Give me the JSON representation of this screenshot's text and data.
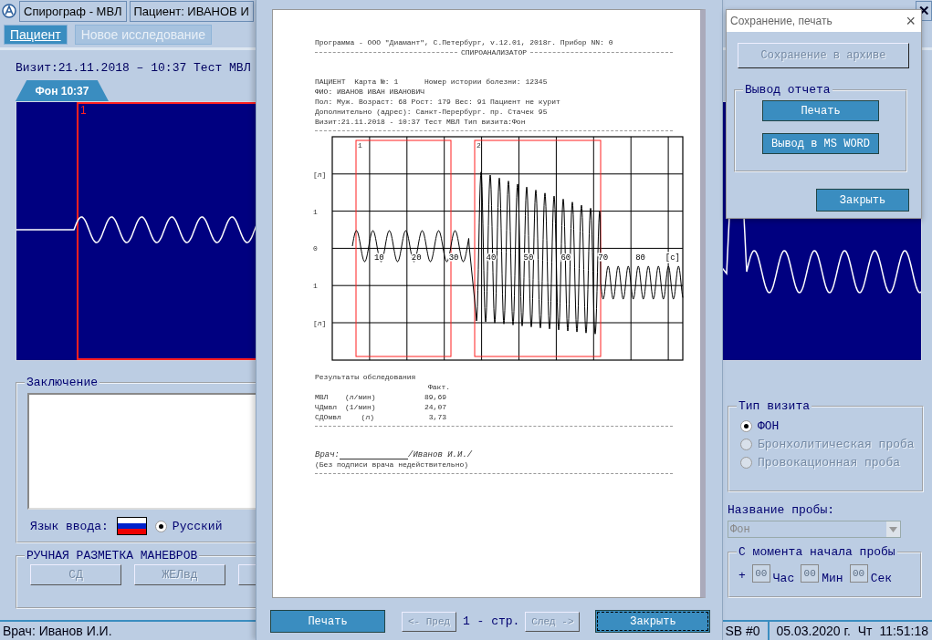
{
  "app": {
    "title": "Спирограф - МВЛ",
    "patient": "Пациент: ИВАНОВ И",
    "close_button": "✕"
  },
  "menu": [
    {
      "label": "Пациент",
      "disabled": false
    },
    {
      "label": "Новое исследование",
      "disabled": true
    }
  ],
  "visit_line": "Визит:21.11.2018 – 10:37 Тест МВЛ",
  "tabs": [
    {
      "label": "Фон 10:37",
      "selected": true
    }
  ],
  "trace": {
    "segment_label": "1"
  },
  "conclusion": {
    "legend": "Заключение",
    "language_label": "Язык ввода:",
    "language": {
      "label": "Русский",
      "selected": true
    }
  },
  "maneuvers": {
    "legend": "РУЧНАЯ РАЗМЕТКА МАНЕВРОВ",
    "buttons": [
      {
        "label": "СД",
        "disabled": true
      },
      {
        "label": "ЖЕЛвд",
        "disabled": true
      },
      {
        "disabled": true
      }
    ]
  },
  "visit_type": {
    "legend": "Тип визита",
    "options": [
      {
        "label": "ФОН",
        "selected": true,
        "disabled": false
      },
      {
        "label": "Бронхолитическая проба",
        "selected": false,
        "disabled": true
      },
      {
        "label": "Провокационная проба",
        "selected": false,
        "disabled": true
      }
    ]
  },
  "test_name": {
    "label": "Название пробы:",
    "value": "Фон",
    "disabled": true
  },
  "elapsed": {
    "legend": "С момента начала пробы",
    "prefix": "+",
    "fields": [
      {
        "placeholder": "00",
        "unit": "Час"
      },
      {
        "placeholder": "00",
        "unit": "Мин"
      },
      {
        "placeholder": "00",
        "unit": "Сек"
      }
    ]
  },
  "status_bar": {
    "doctor": "Врач: Иванов И.И.",
    "sb": "SB #0",
    "date": "05.03.2020 г.",
    "weekday": "Чт",
    "time": "11:51:18"
  },
  "preview": {
    "report": {
      "header": "Программа - ООО \"Диамант\", С.Петербург, v.12.01, 2018г. Прибор NN: 0",
      "section": "СПИРОАНАЛИЗАТОР",
      "patient_lines": [
        "ПАЦИЕНТ  Карта №: 1      Номер истории болезни: 12345",
        "ФИО: ИВАНОВ ИВАН ИВАНОВИЧ",
        "Пол: Муж. Возраст: 68 Рост: 179 Вес: 91 Пациент не курит",
        "Дополнительно (адрес): Санкт-Перербург. пр. Стачек 95",
        "Визит:21.11.2018 - 10:37 Тест МВЛ Тип визита:Фон"
      ],
      "chart": {
        "y_labels": [
          "[л]",
          "1",
          "0",
          "1",
          "[л]"
        ],
        "x_labels": [
          "10",
          "20",
          "30",
          "40",
          "50",
          "60",
          "70",
          "80",
          "[с]"
        ],
        "segments": [
          {
            "label": "1"
          },
          {
            "label": "2"
          }
        ]
      },
      "results_title": "Результаты обследования",
      "results_header": "Факт.",
      "results": [
        {
          "name": "МВЛ",
          "unit": "(л/мин)",
          "value": "89,69"
        },
        {
          "name": "ЧДмвл",
          "unit": "(1/мин)",
          "value": "24,07"
        },
        {
          "name": "СДОмвл",
          "unit": "(л)",
          "value": "3,73"
        }
      ],
      "doctor_label": "Врач:",
      "doctor_name": "/Иванов И.И./",
      "signature_note": "(Без подписи врача недействительно)"
    },
    "buttons": [
      {
        "label": "Печать",
        "kind": "action",
        "disabled": false,
        "focused": false
      },
      {
        "label": "<- Пред",
        "kind": "nav",
        "disabled": true
      },
      {
        "label": "1 - стр.",
        "kind": "page"
      },
      {
        "label": "След ->",
        "kind": "nav",
        "disabled": true
      },
      {
        "label": "Закрыть",
        "kind": "action",
        "disabled": false,
        "focused": true
      }
    ]
  },
  "dialog": {
    "title": "Сохранение, печать",
    "close": "×",
    "archive_button": {
      "label": "Сохранение в архиве",
      "disabled": true
    },
    "report_legend": "Вывод отчета",
    "report_buttons": [
      "Печать",
      "Вывод в MS WORD"
    ],
    "close_button": "Закрыть"
  }
}
